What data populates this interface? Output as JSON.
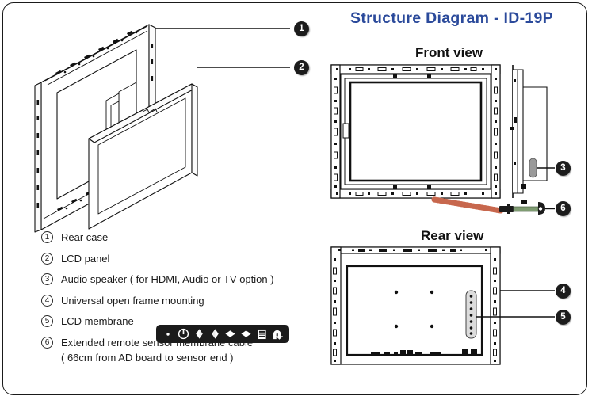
{
  "document": {
    "title": "Structure Diagram  -  ID-19P",
    "title_color": "#2b4a9b",
    "border_color": "#1a1a1a",
    "background": "#ffffff"
  },
  "views": {
    "front": {
      "label": "Front view"
    },
    "rear": {
      "label": "Rear view"
    }
  },
  "callouts": [
    {
      "id": "1",
      "label": "1",
      "target": "rear-case"
    },
    {
      "id": "2",
      "label": "2",
      "target": "lcd-panel"
    },
    {
      "id": "3",
      "label": "3",
      "target": "audio-speaker"
    },
    {
      "id": "4",
      "label": "4",
      "target": "open-frame-mounting"
    },
    {
      "id": "5",
      "label": "5",
      "target": "lcd-membrane"
    },
    {
      "id": "6",
      "label": "6",
      "target": "remote-sensor-cable"
    }
  ],
  "legend": {
    "items": [
      {
        "num": "1",
        "text": "Rear case"
      },
      {
        "num": "2",
        "text": "LCD panel"
      },
      {
        "num": "3",
        "text": "Audio speaker ( for HDMI, Audio or TV option )"
      },
      {
        "num": "4",
        "text": "Universal open frame mounting"
      },
      {
        "num": "5",
        "text": "LCD membrane"
      },
      {
        "num": "6",
        "text": "Extended remote sensor membrane cable",
        "subtext": "( 66cm from AD board to sensor end )"
      }
    ]
  },
  "keypad": {
    "background": "#1b1b1b",
    "keys": [
      {
        "name": "led-indicator-icon",
        "glyph": "dot"
      },
      {
        "name": "power-icon",
        "glyph": "power"
      },
      {
        "name": "arrow-up-icon",
        "glyph": "up"
      },
      {
        "name": "arrow-down-icon",
        "glyph": "down"
      },
      {
        "name": "arrow-left-icon",
        "glyph": "left"
      },
      {
        "name": "arrow-right-icon",
        "glyph": "right"
      },
      {
        "name": "menu-icon",
        "glyph": "menu"
      },
      {
        "name": "return-exit-icon",
        "glyph": "return"
      }
    ]
  },
  "colors": {
    "line": "#111111",
    "cable_ribbon": "#e79b84",
    "cable_sensor": "#7f9c72",
    "speaker_fill": "#9a9a9a",
    "callout_fill": "#1c1c1c"
  }
}
